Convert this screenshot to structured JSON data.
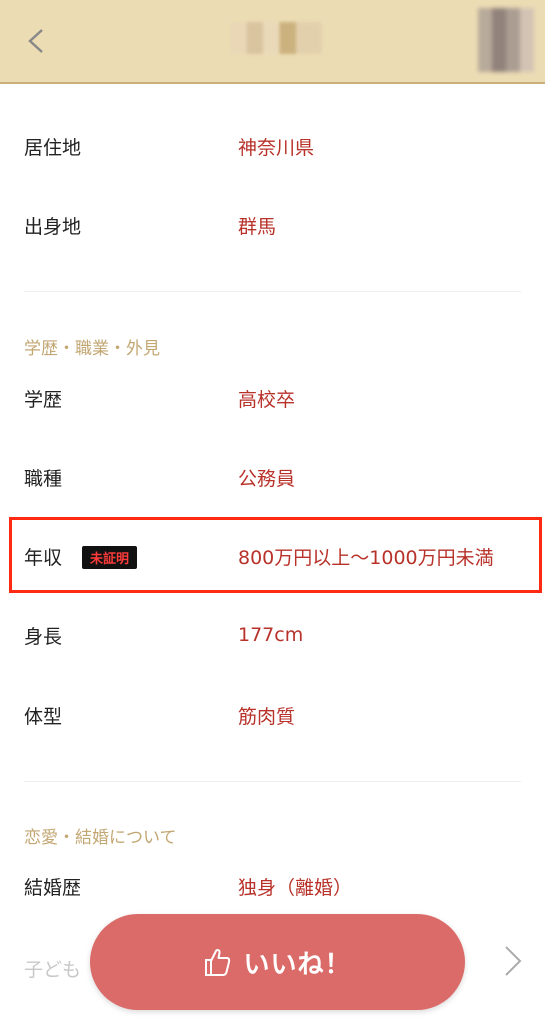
{
  "header": {
    "back_icon": "chevron-left-icon",
    "title_blurred": true,
    "avatar_blurred": true
  },
  "profile": {
    "residence": {
      "label": "居住地",
      "value": "神奈川県"
    },
    "birthplace": {
      "label": "出身地",
      "value": "群馬"
    },
    "section_education": "学歴・職業・外見",
    "education": {
      "label": "学歴",
      "value": "高校卒"
    },
    "occupation": {
      "label": "職種",
      "value": "公務員"
    },
    "income": {
      "label": "年収",
      "badge": "未証明",
      "value": "800万円以上〜1000万円未満"
    },
    "height": {
      "label": "身長",
      "value": "177cm"
    },
    "body_type": {
      "label": "体型",
      "value": "筋肉質"
    },
    "section_love": "恋愛・結婚について",
    "marital_history": {
      "label": "結婚歴",
      "value": "独身（離婚）"
    },
    "children_label_partial": "子ども"
  },
  "footer": {
    "like_label": "いいね！",
    "like_icon": "thumbs-up-icon",
    "next_icon": "chevron-right-icon"
  },
  "colors": {
    "header_bg": "#ecdcb4",
    "value_text": "#b8322a",
    "section_text": "#c3a773",
    "like_button": "#db6b69",
    "highlight_border": "#ff2a12"
  }
}
